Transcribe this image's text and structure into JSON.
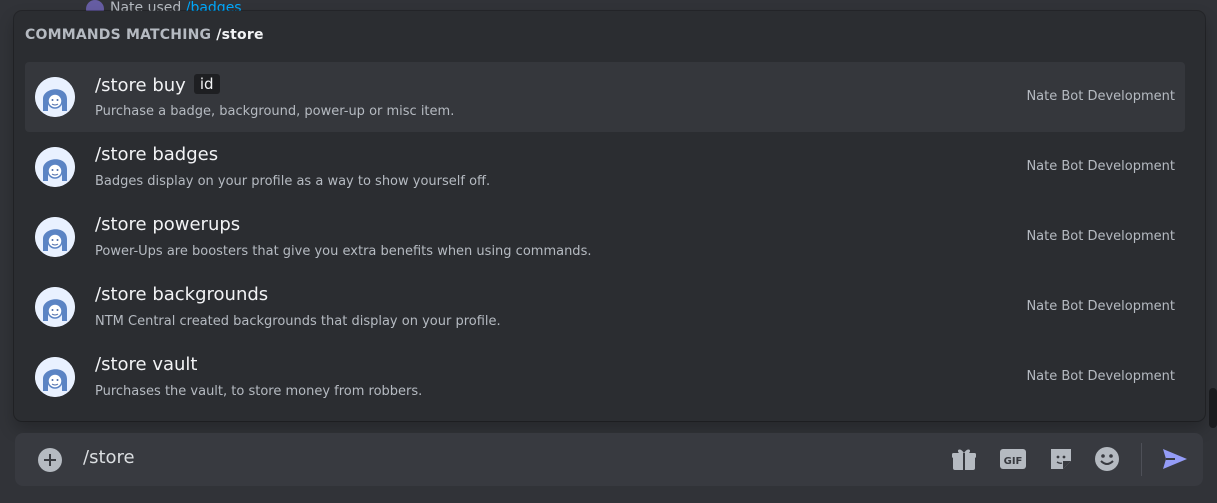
{
  "background": {
    "user": "Nate",
    "used_text": "used",
    "command": "/badges"
  },
  "autocomplete": {
    "header_label": "COMMANDS MATCHING",
    "header_query": "/store",
    "commands": [
      {
        "name": "/store buy",
        "option": "id",
        "description": "Purchase a badge, background, power-up or misc item.",
        "source": "Nate Bot Development",
        "selected": true
      },
      {
        "name": "/store badges",
        "option": "",
        "description": "Badges display on your profile as a way to show yourself off.",
        "source": "Nate Bot Development"
      },
      {
        "name": "/store powerups",
        "option": "",
        "description": "Power-Ups are boosters that give you extra benefits when using commands.",
        "source": "Nate Bot Development"
      },
      {
        "name": "/store backgrounds",
        "option": "",
        "description": "NTM Central created backgrounds that display on your profile.",
        "source": "Nate Bot Development"
      },
      {
        "name": "/store vault",
        "option": "",
        "description": "Purchases the vault, to store money from robbers.",
        "source": "Nate Bot Development"
      }
    ]
  },
  "composer": {
    "value": "/store",
    "icons": [
      "add-icon",
      "gift-icon",
      "gif-icon",
      "sticker-icon",
      "emoji-icon",
      "send-icon"
    ],
    "gif_label": "GIF"
  },
  "colors": {
    "background": "#313338",
    "popup": "#2b2d31",
    "selected_row": "#35373c",
    "send": "#949cf7"
  }
}
